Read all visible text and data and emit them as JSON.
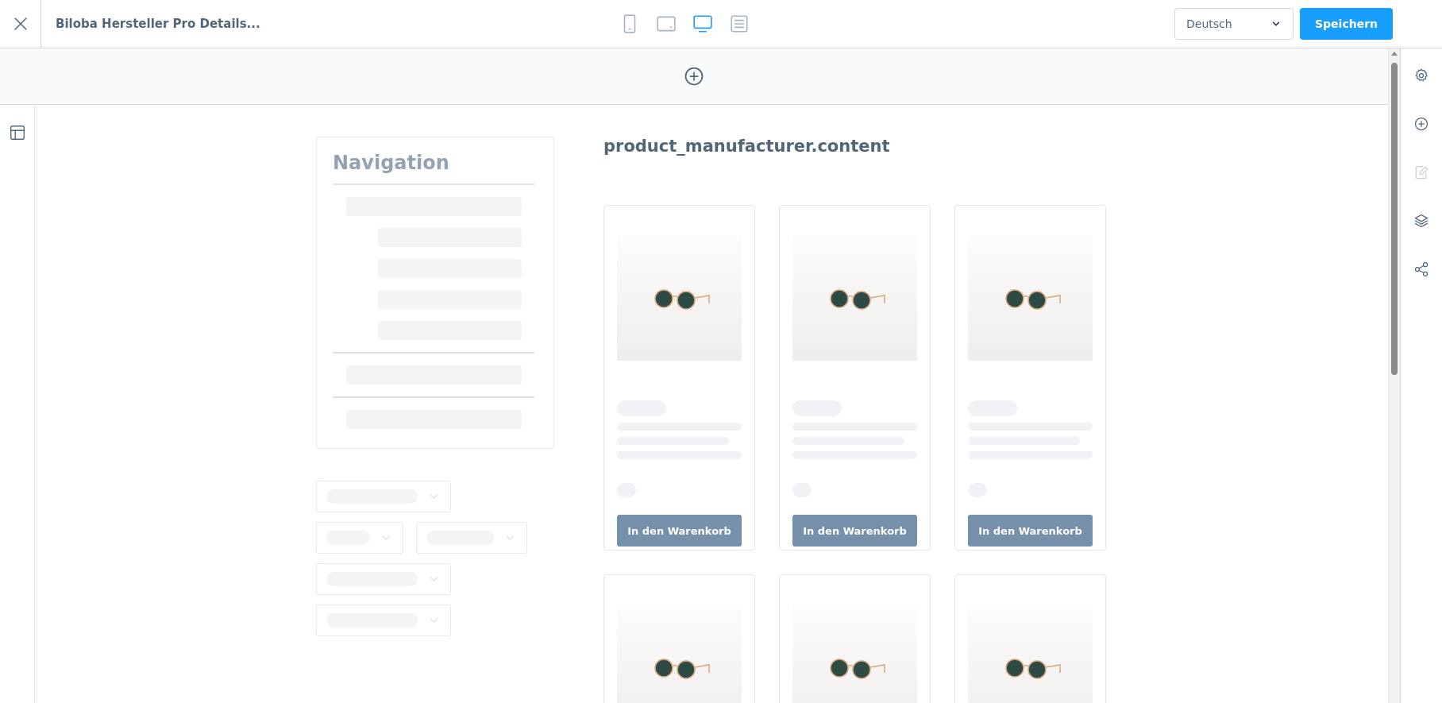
{
  "toolbar": {
    "title": "Biloba Hersteller Pro Details...",
    "devices": [
      {
        "kind": "mobile",
        "selected": false
      },
      {
        "kind": "tablet",
        "selected": false
      },
      {
        "kind": "desktop",
        "selected": true
      },
      {
        "kind": "list",
        "selected": false
      }
    ],
    "language": "Deutsch",
    "save": "Speichern"
  },
  "sidebar": {
    "items": [
      {
        "kind": "settings",
        "disabled": false
      },
      {
        "kind": "add",
        "disabled": false
      },
      {
        "kind": "edit",
        "disabled": true
      },
      {
        "kind": "layers",
        "disabled": false
      },
      {
        "kind": "share",
        "disabled": false
      }
    ]
  },
  "content": {
    "heading": "product_manufacturer.content",
    "navigation": {
      "title": "Navigation"
    },
    "products": [
      {
        "kind": "full",
        "button": "In den Warenkorb"
      },
      {
        "kind": "full",
        "button": "In den Warenkorb"
      },
      {
        "kind": "full",
        "button": "In den Warenkorb"
      },
      {
        "kind": "image_only"
      },
      {
        "kind": "image_only"
      },
      {
        "kind": "image_only"
      }
    ]
  }
}
